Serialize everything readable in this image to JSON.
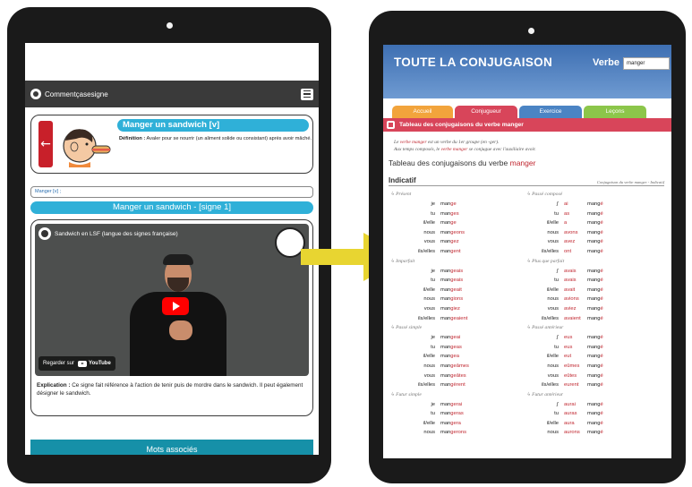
{
  "left_app": {
    "brand": "Commentçasesigne",
    "card": {
      "title": "Manger un sandwich [v]",
      "definition_label": "Définition :",
      "definition_text": "Avaler pour se nourrir (un aliment solide ou consistant) après avoir mâché."
    },
    "breadcrumb": "Manger [v] ;",
    "sign_title": "Manger un sandwich - [signe 1]",
    "video": {
      "title": "Sandwich en LSF (langue des signes française)",
      "watch_on": "Regarder sur",
      "youtube": "YouTube"
    },
    "explanation_label": "Explication :",
    "explanation_text": "Ce signe fait référence à l'action de tenir puis de mordre dans le sandwich. Il peut également désigner le sandwich.",
    "related_button": "Mots associés"
  },
  "right_app": {
    "site_title": "TOUTE LA CONJUGAISON",
    "verb_label": "Verbe",
    "verb_value": "manger",
    "tabs": [
      "Accueil",
      "Conjugueur",
      "Exercice",
      "Leçons"
    ],
    "band_title": "Tableau des conjugaisons du verbe manger",
    "intro": {
      "line1_a": "Le ",
      "line1_verb": "verbe manger",
      "line1_b": " est un verbe du 1er groupe (en -ger).",
      "line2_a": "Aux temps composés, le ",
      "line2_verb": "verbe manger",
      "line2_b": " se conjugue avec l'auxiliaire avoir."
    },
    "h2_prefix": "Tableau des conjugaisons du verbe ",
    "h2_verb": "manger",
    "mode": "Indicatif",
    "mode_link": "Conjugaison du verbe manger - Indicatif",
    "simple_tenses": [
      {
        "name": "Présent",
        "rows": [
          [
            "je",
            "man",
            "ge"
          ],
          [
            "tu",
            "man",
            "ges"
          ],
          [
            "il/elle",
            "man",
            "ge"
          ],
          [
            "nous",
            "man",
            "geons"
          ],
          [
            "vous",
            "man",
            "gez"
          ],
          [
            "ils/elles",
            "man",
            "gent"
          ]
        ]
      },
      {
        "name": "Imparfait",
        "rows": [
          [
            "je",
            "man",
            "geais"
          ],
          [
            "tu",
            "man",
            "geais"
          ],
          [
            "il/elle",
            "man",
            "geait"
          ],
          [
            "nous",
            "man",
            "gions"
          ],
          [
            "vous",
            "man",
            "giez"
          ],
          [
            "ils/elles",
            "man",
            "geaient"
          ]
        ]
      },
      {
        "name": "Passé simple",
        "rows": [
          [
            "je",
            "man",
            "geai"
          ],
          [
            "tu",
            "man",
            "geas"
          ],
          [
            "il/elle",
            "man",
            "gea"
          ],
          [
            "nous",
            "man",
            "geâmes"
          ],
          [
            "vous",
            "man",
            "geâtes"
          ],
          [
            "ils/elles",
            "man",
            "gèrent"
          ]
        ]
      },
      {
        "name": "Futur simple",
        "rows": [
          [
            "je",
            "man",
            "gerai"
          ],
          [
            "tu",
            "man",
            "geras"
          ],
          [
            "il/elle",
            "man",
            "gera"
          ],
          [
            "nous",
            "man",
            "gerons"
          ]
        ]
      }
    ],
    "compound_tenses": [
      {
        "name": "Passé composé",
        "rows": [
          [
            "j'",
            "ai",
            "mang",
            "é"
          ],
          [
            "tu",
            "as",
            "mang",
            "é"
          ],
          [
            "il/elle",
            "a",
            "mang",
            "é"
          ],
          [
            "nous",
            "avons",
            "mang",
            "é"
          ],
          [
            "vous",
            "avez",
            "mang",
            "é"
          ],
          [
            "ils/elles",
            "ont",
            "mang",
            "é"
          ]
        ]
      },
      {
        "name": "Plus que parfait",
        "rows": [
          [
            "j'",
            "avais",
            "mang",
            "é"
          ],
          [
            "tu",
            "avais",
            "mang",
            "é"
          ],
          [
            "il/elle",
            "avait",
            "mang",
            "é"
          ],
          [
            "nous",
            "avions",
            "mang",
            "é"
          ],
          [
            "vous",
            "aviez",
            "mang",
            "é"
          ],
          [
            "ils/elles",
            "avaient",
            "mang",
            "é"
          ]
        ]
      },
      {
        "name": "Passé antérieur",
        "rows": [
          [
            "j'",
            "eus",
            "mang",
            "é"
          ],
          [
            "tu",
            "eus",
            "mang",
            "é"
          ],
          [
            "il/elle",
            "eut",
            "mang",
            "é"
          ],
          [
            "nous",
            "eûmes",
            "mang",
            "é"
          ],
          [
            "vous",
            "eûtes",
            "mang",
            "é"
          ],
          [
            "ils/elles",
            "eurent",
            "mang",
            "é"
          ]
        ]
      },
      {
        "name": "Futur antérieur",
        "rows": [
          [
            "j'",
            "aurai",
            "mang",
            "é"
          ],
          [
            "tu",
            "auras",
            "mang",
            "é"
          ],
          [
            "il/elle",
            "aura",
            "mang",
            "é"
          ],
          [
            "nous",
            "aurons",
            "mang",
            "é"
          ]
        ]
      }
    ]
  },
  "colors": {
    "accent_blue": "#2fb0d8",
    "accent_red": "#c0262f",
    "arrow_yellow": "#e8d531",
    "teal_button": "#1690a8"
  }
}
